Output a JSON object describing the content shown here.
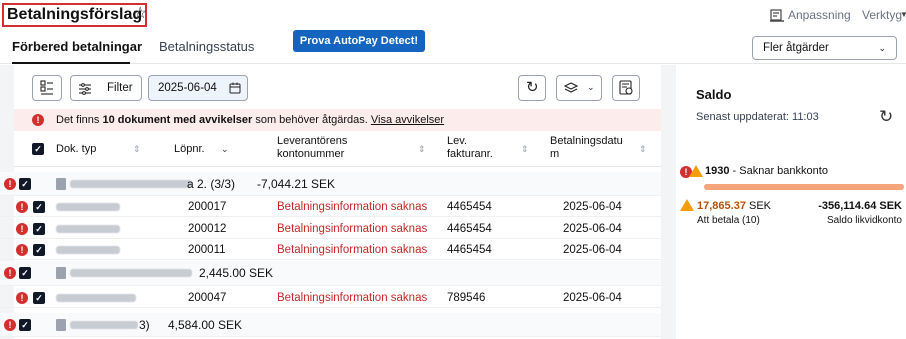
{
  "header": {
    "title": "Betalningsförslag",
    "favorite_icon": "star-icon",
    "customize_label": "Anpassning",
    "tools_label": "Verktyg"
  },
  "tabs": [
    {
      "label": "Förbered betalningar",
      "active": true
    },
    {
      "label": "Betalningsstatus",
      "active": false
    }
  ],
  "promo_label": "Prova AutoPay Detect!",
  "more_actions_label": "Fler åtgärder",
  "toolbar": {
    "filter_label": "Filter",
    "date_value": "2025-06-04"
  },
  "alert": {
    "prefix": "Det finns ",
    "count_text": "10 dokument med avvikelser",
    "suffix": " som behöver åtgärdas. ",
    "link": "Visa avvikelser"
  },
  "columns": {
    "doc_type": "Dok. typ",
    "serial": "Löpnr.",
    "supplier_account_1": "Leverantörens",
    "supplier_account_2": "kontonummer",
    "invoice_1": "Lev.",
    "invoice_2": "fakturanr.",
    "paydate_1": "Betalningsdatu",
    "paydate_2": "m"
  },
  "groups": [
    {
      "suffix": "a 2. (3/3)",
      "amount": "-7,044.21 SEK",
      "rows": [
        {
          "serial": "200017",
          "account": "Betalningsinformation saknas",
          "invoice": "4465454",
          "date": "2025-06-04"
        },
        {
          "serial": "200012",
          "account": "Betalningsinformation saknas",
          "invoice": "4465454",
          "date": "2025-06-04"
        },
        {
          "serial": "200011",
          "account": "Betalningsinformation saknas",
          "invoice": "4465454",
          "date": "2025-06-04"
        }
      ]
    },
    {
      "suffix": "",
      "amount": "2,445.00 SEK",
      "rows": [
        {
          "serial": "200047",
          "account": "Betalningsinformation saknas",
          "invoice": "789546",
          "date": "2025-06-04"
        }
      ]
    },
    {
      "suffix": "3)",
      "amount": "4,584.00 SEK",
      "rows": []
    }
  ],
  "saldo": {
    "title": "Saldo",
    "updated": "Senast uppdaterat: 11:03",
    "account_number": "1930",
    "account_note": " - Saknar bankkonto",
    "to_pay_amount": "17,865.37",
    "to_pay_currency": " SEK",
    "to_pay_label": "Att betala (10)",
    "liquidity_amount": "-356,114.64 SEK",
    "liquidity_label": "Saldo likvidkonto"
  },
  "colors": {
    "accent": "#1565c0",
    "error": "#d32f2f",
    "warning": "#f59e0b",
    "balance_bar": "#f4a57a"
  }
}
